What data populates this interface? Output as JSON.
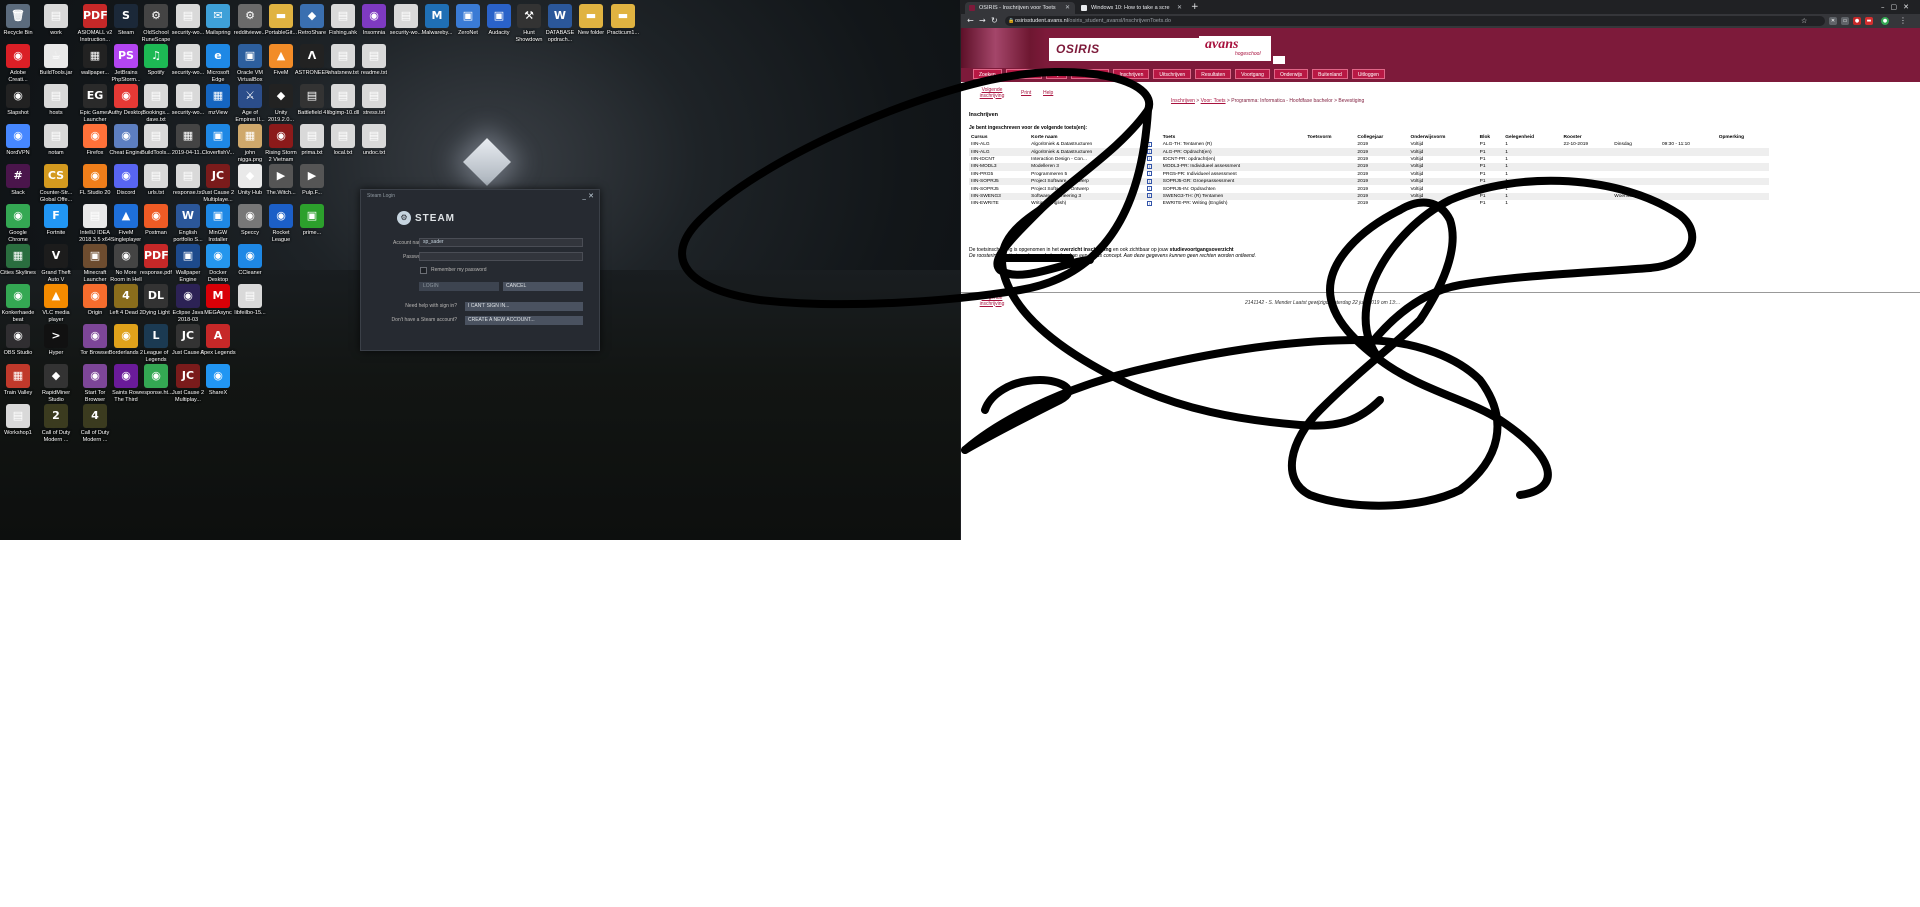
{
  "desktop": {
    "icons": [
      {
        "label": "Recycle Bin",
        "glyph": "🗑",
        "color": "#5b6b7d"
      },
      {
        "label": "work",
        "glyph": "▤",
        "color": "#d9d9d9"
      },
      {
        "label": "ASIOMALL v2 Instruction...",
        "glyph": "PDF",
        "color": "#c62828"
      },
      {
        "label": "Steam",
        "glyph": "S",
        "color": "#1b2838"
      },
      {
        "label": "OldSchool RuneScape",
        "glyph": "⚙",
        "color": "#444"
      },
      {
        "label": "security-wo...",
        "glyph": "▤",
        "color": "#d9d9d9"
      },
      {
        "label": "Mailspring",
        "glyph": "✉",
        "color": "#3ea0d8"
      },
      {
        "label": "redditviewe...",
        "glyph": "⚙",
        "color": "#6a6a6a"
      },
      {
        "label": "PortableGit...",
        "glyph": "▬",
        "color": "#e0b341"
      },
      {
        "label": "RetroShare",
        "glyph": "◆",
        "color": "#3a6fb0"
      },
      {
        "label": "Fishing.ahk",
        "glyph": "▤",
        "color": "#d9d9d9"
      },
      {
        "label": "Insomnia",
        "glyph": "◉",
        "color": "#7e3ac1"
      },
      {
        "label": "security-wo...",
        "glyph": "▤",
        "color": "#d9d9d9"
      },
      {
        "label": "Malwareby...",
        "glyph": "M",
        "color": "#1f6fb5"
      },
      {
        "label": "ZeroNet",
        "glyph": "▣",
        "color": "#3a7bd5"
      },
      {
        "label": "Audacity",
        "glyph": "▣",
        "color": "#2a62c9"
      },
      {
        "label": "Hunt Showdown",
        "glyph": "⚒",
        "color": "#333"
      },
      {
        "label": "DATABASE opdrach...",
        "glyph": "W",
        "color": "#2b579a"
      },
      {
        "label": "New folder",
        "glyph": "▬",
        "color": "#e0b341"
      },
      {
        "label": "Practicum1...",
        "glyph": "▬",
        "color": "#e0b341"
      },
      {
        "label": "Adobe Creati...",
        "glyph": "◉",
        "color": "#da1f26"
      },
      {
        "label": "BuildTools.jar",
        "glyph": "☕",
        "color": "#e9e9e9"
      },
      {
        "label": "wallpaper...",
        "glyph": "▦",
        "color": "#222"
      },
      {
        "label": "JetBrains PhpStorm...",
        "glyph": "PS",
        "color": "#b345f1"
      },
      {
        "label": "Spotify",
        "glyph": "♫",
        "color": "#1db954"
      },
      {
        "label": "security-wo...",
        "glyph": "▤",
        "color": "#d9d9d9"
      },
      {
        "label": "Microsoft Edge",
        "glyph": "e",
        "color": "#1e88e5"
      },
      {
        "label": "Oracle VM VirtualBox",
        "glyph": "▣",
        "color": "#2d5f9e"
      },
      {
        "label": "FiveM",
        "glyph": "▲",
        "color": "#f28c28"
      },
      {
        "label": "ASTRONEER",
        "glyph": "Λ",
        "color": "#222"
      },
      {
        "label": "whatsnew.txt",
        "glyph": "▤",
        "color": "#d9d9d9"
      },
      {
        "label": "readme.txt",
        "glyph": "▤",
        "color": "#d9d9d9"
      },
      {
        "label": "Slapshot",
        "glyph": "◉",
        "color": "#222"
      },
      {
        "label": "hosts",
        "glyph": "▤",
        "color": "#d9d9d9"
      },
      {
        "label": "Epic Games Launcher",
        "glyph": "EG",
        "color": "#2a2a2a"
      },
      {
        "label": "Authy Desktop",
        "glyph": "◉",
        "color": "#e53935"
      },
      {
        "label": "Bookings... dave.txt",
        "glyph": "▤",
        "color": "#d9d9d9"
      },
      {
        "label": "security-wo...",
        "glyph": "▤",
        "color": "#d9d9d9"
      },
      {
        "label": "mzView",
        "glyph": "▦",
        "color": "#1565c0"
      },
      {
        "label": "Age of Empires II...",
        "glyph": "⚔",
        "color": "#2b4d8a"
      },
      {
        "label": "Unity 2019.2.0...",
        "glyph": "◆",
        "color": "#222"
      },
      {
        "label": "Battlefield 4",
        "glyph": "▤",
        "color": "#333"
      },
      {
        "label": "libgimp-10.dll",
        "glyph": "▤",
        "color": "#d9d9d9"
      },
      {
        "label": "stress.txt",
        "glyph": "▤",
        "color": "#d9d9d9"
      },
      {
        "label": "NordVPN",
        "glyph": "◉",
        "color": "#4687ff"
      },
      {
        "label": "notam",
        "glyph": "▤",
        "color": "#d9d9d9"
      },
      {
        "label": "Firefox",
        "glyph": "◉",
        "color": "#ff7139"
      },
      {
        "label": "Cheat Engine",
        "glyph": "◉",
        "color": "#5d7fc1"
      },
      {
        "label": "BuildTools...",
        "glyph": "▤",
        "color": "#d9d9d9"
      },
      {
        "label": "2019-04-11...",
        "glyph": "▦",
        "color": "#444"
      },
      {
        "label": "CloverfishV...",
        "glyph": "▣",
        "color": "#1e88e5"
      },
      {
        "label": "john nigga.png",
        "glyph": "▦",
        "color": "#cfa86b"
      },
      {
        "label": "Rising Storm 2 Vietnam",
        "glyph": "◉",
        "color": "#8b1a1a"
      },
      {
        "label": "prima.txt",
        "glyph": "▤",
        "color": "#d9d9d9"
      },
      {
        "label": "local.txt",
        "glyph": "▤",
        "color": "#d9d9d9"
      },
      {
        "label": "undoc.txt",
        "glyph": "▤",
        "color": "#d9d9d9"
      },
      {
        "label": "Slack",
        "glyph": "#",
        "color": "#4a154b"
      },
      {
        "label": "Counter-Str... Global Offe...",
        "glyph": "CS",
        "color": "#d49a1f"
      },
      {
        "label": "FL Studio 20",
        "glyph": "◉",
        "color": "#ef7e1a"
      },
      {
        "label": "Discord",
        "glyph": "◉",
        "color": "#5865f2"
      },
      {
        "label": "urls.txt",
        "glyph": "▤",
        "color": "#d9d9d9"
      },
      {
        "label": "response.txt",
        "glyph": "▤",
        "color": "#d9d9d9"
      },
      {
        "label": "Just Cause 2 Multiplaye...",
        "glyph": "JC",
        "color": "#7a1b1b"
      },
      {
        "label": "Unity Hub",
        "glyph": "◆",
        "color": "#e9e9e9"
      },
      {
        "label": "The.Witch...",
        "glyph": "▶",
        "color": "#555"
      },
      {
        "label": "Pulp.F...",
        "glyph": "▶",
        "color": "#555"
      },
      {
        "label": "Google Chrome",
        "glyph": "◉",
        "color": "#34a853"
      },
      {
        "label": "Fortnite",
        "glyph": "F",
        "color": "#2196f3"
      },
      {
        "label": "IntelliJ IDEA 2018.3.5 x64",
        "glyph": "▤",
        "color": "#e9e9e9"
      },
      {
        "label": "FiveM Singleplayer",
        "glyph": "▲",
        "color": "#1e6fd9"
      },
      {
        "label": "Postman",
        "glyph": "◉",
        "color": "#ef5b25"
      },
      {
        "label": "English portfolio S...",
        "glyph": "W",
        "color": "#2b579a"
      },
      {
        "label": "MinGW Installer",
        "glyph": "▣",
        "color": "#1e88e5"
      },
      {
        "label": "Speccy",
        "glyph": "◉",
        "color": "#777"
      },
      {
        "label": "Rocket League",
        "glyph": "◉",
        "color": "#1c5fc7"
      },
      {
        "label": "prime...",
        "glyph": "▣",
        "color": "#2ca02c"
      },
      {
        "label": "Cities Skylines",
        "glyph": "▦",
        "color": "#2a6e3f"
      },
      {
        "label": "Grand Theft Auto V",
        "glyph": "V",
        "color": "#1c1c1c"
      },
      {
        "label": "Minecraft Launcher",
        "glyph": "▣",
        "color": "#6d4c2f"
      },
      {
        "label": "No More Room in Hell",
        "glyph": "◉",
        "color": "#444"
      },
      {
        "label": "response.pdf",
        "glyph": "PDF",
        "color": "#c62828"
      },
      {
        "label": "Wallpaper Engine",
        "glyph": "▣",
        "color": "#1d4a8c"
      },
      {
        "label": "Docker Desktop",
        "glyph": "◉",
        "color": "#2496ed"
      },
      {
        "label": "CCleaner",
        "glyph": "◉",
        "color": "#1e88e5"
      },
      {
        "label": "Konkerhaede beat",
        "glyph": "◉",
        "color": "#34a853"
      },
      {
        "label": "VLC media player",
        "glyph": "▲",
        "color": "#f48b00"
      },
      {
        "label": "Origin",
        "glyph": "◉",
        "color": "#f56c2d"
      },
      {
        "label": "Left 4 Dead 2",
        "glyph": "4",
        "color": "#8a6d1c"
      },
      {
        "label": "Dying Light",
        "glyph": "DL",
        "color": "#333"
      },
      {
        "label": "Eclipse Java 2018-03",
        "glyph": "◉",
        "color": "#2c2255"
      },
      {
        "label": "MEGAsync",
        "glyph": "M",
        "color": "#d90007"
      },
      {
        "label": "libfeilbo-15...",
        "glyph": "▤",
        "color": "#d9d9d9"
      },
      {
        "label": "OBS Studio",
        "glyph": "◉",
        "color": "#302e31"
      },
      {
        "label": "Hyper",
        "glyph": ">",
        "color": "#111"
      },
      {
        "label": "Tor Browser",
        "glyph": "◉",
        "color": "#7d4698"
      },
      {
        "label": "Borderlands 2",
        "glyph": "◉",
        "color": "#e0a21b"
      },
      {
        "label": "League of Legends",
        "glyph": "L",
        "color": "#1b3a52"
      },
      {
        "label": "Just Cause 2",
        "glyph": "JC",
        "color": "#333"
      },
      {
        "label": "Apex Legends",
        "glyph": "A",
        "color": "#c62828"
      },
      {
        "label": "Train Valley",
        "glyph": "▦",
        "color": "#c0392b"
      },
      {
        "label": "RapidMiner Studio",
        "glyph": "◆",
        "color": "#333"
      },
      {
        "label": "Start Tor Browser",
        "glyph": "◉",
        "color": "#7d4698"
      },
      {
        "label": "Saints Row The Third",
        "glyph": "◉",
        "color": "#6a1b9a"
      },
      {
        "label": "response.ht...",
        "glyph": "◉",
        "color": "#34a853"
      },
      {
        "label": "Just Cause 2 Multiplay...",
        "glyph": "JC",
        "color": "#7a1b1b"
      },
      {
        "label": "ShareX",
        "glyph": "◉",
        "color": "#2196f3"
      },
      {
        "label": "Workshop1",
        "glyph": "▤",
        "color": "#d9d9d9"
      },
      {
        "label": "Call of Duty Modern ...",
        "glyph": "2",
        "color": "#3b3b1f"
      },
      {
        "label": "Call of Duty Modern ...",
        "glyph": "4",
        "color": "#3b3b1f"
      }
    ]
  },
  "steam": {
    "window_title": "Steam Login",
    "logo_text": "STEAM",
    "account_label": "Account name",
    "account_value": "sp_sader",
    "password_label": "Password",
    "remember_label": "Remember my password",
    "login_button": "LOGIN",
    "cancel_button": "CANCEL",
    "help_label": "Need help with sign in?",
    "help_button": "I CAN'T SIGN IN...",
    "create_label": "Don't have a Steam account?",
    "create_button": "CREATE A NEW ACCOUNT..."
  },
  "browser": {
    "tabs": [
      {
        "title": "OSIRIS - Inschrijven voor Toets",
        "active": true,
        "favicon_color": "#7d1a3a"
      },
      {
        "title": "Windows 10: How to take a scre",
        "active": false,
        "favicon_color": "#e8eaed"
      }
    ],
    "new_tab": "+",
    "url_host": "osirisstudent.avans.nl",
    "url_path": "/osiris_student_avansl/InschrijvenToets.do"
  },
  "osiris": {
    "title": "OSIRIS",
    "logo": "avans",
    "logo_sub": "hogeschool",
    "menu": [
      "Zoeken",
      "Persoonlijk",
      "Mijn",
      "Begeleiding",
      "Inschrijven",
      "Uitschrijven",
      "Resultaten",
      "Voortgang",
      "Onderwijs",
      "Buitenland",
      "Uitloggen"
    ],
    "subnav_next": "Volgende inschrijving",
    "subnav_print": "Print",
    "subnav_help": "Help",
    "breadcrumb": [
      "Inschrijven",
      "Voor: Toets",
      "Programma: Informatica - Hoofdfase bachelor",
      "Bevestiging"
    ],
    "heading": "Inschrijven",
    "intro": "Je bent ingeschreven voor de volgende toets(en):",
    "columns": [
      "Cursus",
      "Korte naam",
      "",
      "Toets",
      "Toetsvorm",
      "Collegejaar",
      "Onderwijsvorm",
      "Blok",
      "Gelegenheid",
      "Rooster",
      "",
      "",
      "Opmerking"
    ],
    "rows": [
      [
        "IIIN-ALG",
        "Algoritmiek & Datastructuren",
        "i",
        "ALG-TH: Tentamen (R)",
        "",
        "2019",
        "Voltijd",
        "P1",
        "1",
        "22-10-2019",
        "Dinsdag",
        "09:30 - 11:10",
        ""
      ],
      [
        "IIIN-ALG",
        "Algoritmiek & Datastructuren",
        "i",
        "ALG-PR: Opdracht(en)",
        "",
        "2019",
        "Voltijd",
        "P1",
        "1",
        "",
        "",
        "",
        ""
      ],
      [
        "IIIN-IDCNT",
        "Interaction Design - Con...",
        "i",
        "IDCNT-PR: opdracht(en)",
        "",
        "2019",
        "Voltijd",
        "P1",
        "1",
        "",
        "",
        "",
        ""
      ],
      [
        "IIIN-MODL3",
        "Modelleren 3",
        "i",
        "MODL3-PR: Individueel assessment",
        "",
        "2019",
        "Voltijd",
        "P1",
        "1",
        "",
        "",
        "",
        ""
      ],
      [
        "IIIN-PRG5",
        "Programmeren 5",
        "i",
        "PRG5-PR: Individueel assessment",
        "",
        "2019",
        "Voltijd",
        "P1",
        "1",
        "",
        "",
        "",
        ""
      ],
      [
        "IIIN-SOPRJ5",
        "Project Software - Ontwerp",
        "i",
        "SOPRJ5-GR: Groepsassessment",
        "",
        "2019",
        "Voltijd",
        "P1",
        "1",
        "",
        "",
        "",
        ""
      ],
      [
        "IIIN-SOPRJ5",
        "Project Software - Ontwerp",
        "i",
        "SOPRJ5-IN: Opdrachten",
        "",
        "2019",
        "Voltijd",
        "P1",
        "1",
        "",
        "",
        "",
        ""
      ],
      [
        "IIIN-SWENG3",
        "Software Engineering 3",
        "i",
        "SWENG3-TH: (R) Tentamen",
        "",
        "2019",
        "Voltijd",
        "P1",
        "1",
        "",
        "Woensdag",
        "",
        ""
      ],
      [
        "IIIN-EWRITE",
        "Writing (English)",
        "i",
        "EWRITE-PR: Writing (English)",
        "",
        "2019",
        "Voltijd",
        "P1",
        "1",
        "",
        "",
        "",
        ""
      ]
    ],
    "foot1_a": "De toetsinschrijving is opgenomen in het",
    "foot1_b": "overzicht inschrijving",
    "foot1_c": "en ook zichtbaar op jouw",
    "foot1_d": "studievoortgangsoverzicht",
    "foot2": "De roosterinformatie is onder voorbehoud en kan een status concept. Aan deze gegevens kunnen geen rechten worden ontleend.",
    "bottom_next": "Volgende inschrijving",
    "bottom_status": "2141142 - S. Mender    Laatst gewijzigd: zaterdag 22 juni 2019 om 13:..."
  }
}
